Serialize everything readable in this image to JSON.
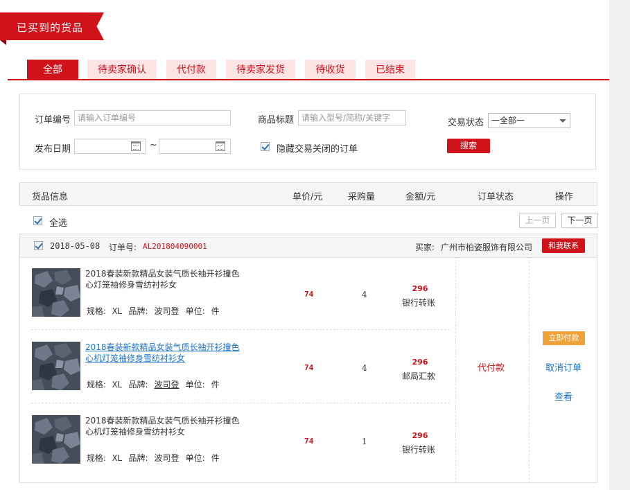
{
  "page_title": "已买到的货品",
  "tabs": [
    {
      "label": "全部",
      "active": true
    },
    {
      "label": "待卖家确认",
      "active": false
    },
    {
      "label": "代付款",
      "active": false
    },
    {
      "label": "待卖家发货",
      "active": false
    },
    {
      "label": "待收货",
      "active": false
    },
    {
      "label": "已结束",
      "active": false
    }
  ],
  "filter": {
    "order_no_label": "订单编号",
    "order_no_placeholder": "请输入订单编号",
    "product_title_label": "商品标题",
    "product_title_placeholder": "请输入型号/简称/关键字",
    "trade_status_label": "交易状态",
    "trade_status_value": "一全部一",
    "publish_date_label": "发布日期",
    "date_separator": "~",
    "hide_closed_label": "隐藏交易关闭的订单",
    "hide_closed_checked": true,
    "search_button": "搜索"
  },
  "table_headers": {
    "goods_info": "货品信息",
    "unit_price": "单价/元",
    "quantity": "采购量",
    "amount": "金额/元",
    "status": "订单状态",
    "actions": "操作"
  },
  "select_all_label": "全选",
  "pager": {
    "prev": "上一页",
    "next": "下一页"
  },
  "order": {
    "date": "2018-05-08",
    "order_no_label": "订单号:",
    "order_no": "AL201804090001",
    "seller_label": "买家:",
    "seller": "广州市柏姿服饰有限公司",
    "contact_button": "和我联系",
    "status": "代付款",
    "pay_now_button": "立即付款",
    "cancel_link": "取消订单",
    "view_link": "查看",
    "items": [
      {
        "title": "2018春装新款精品女装气质长袖开衫撞色心灯笼袖修身雪纺衬衫女",
        "spec_label": "规格:",
        "spec": "XL",
        "brand_label": "品牌:",
        "brand": "波司登",
        "unit_label": "单位:",
        "unit": "件",
        "price": "74",
        "quantity": "4",
        "amount": "296",
        "pay_method": "银行转账"
      },
      {
        "title": "2018春装新款精品女装气质长袖开衫撞色心机灯笼袖修身雪纺衬衫女",
        "spec_label": "规格:",
        "spec": "XL",
        "brand_label": "品牌:",
        "brand": "波司登",
        "unit_label": "单位:",
        "unit": "件",
        "price": "74",
        "quantity": "4",
        "amount": "296",
        "pay_method": "邮局汇款"
      },
      {
        "title": "2018春装新款精品女装气质长袖开衫撞色心机灯笼袖修身雪纺衬衫女",
        "spec_label": "规格:",
        "spec": "XL",
        "brand_label": "品牌:",
        "brand": "波司登",
        "unit_label": "单位:",
        "unit": "件",
        "price": "74",
        "quantity": "1",
        "amount": "296",
        "pay_method": "银行转账"
      }
    ]
  },
  "colors": {
    "brand_red": "#d0121b",
    "tab_inactive_bg": "#fde5e6",
    "pay_orange": "#f0a23a",
    "link_blue": "#1a73c8"
  }
}
